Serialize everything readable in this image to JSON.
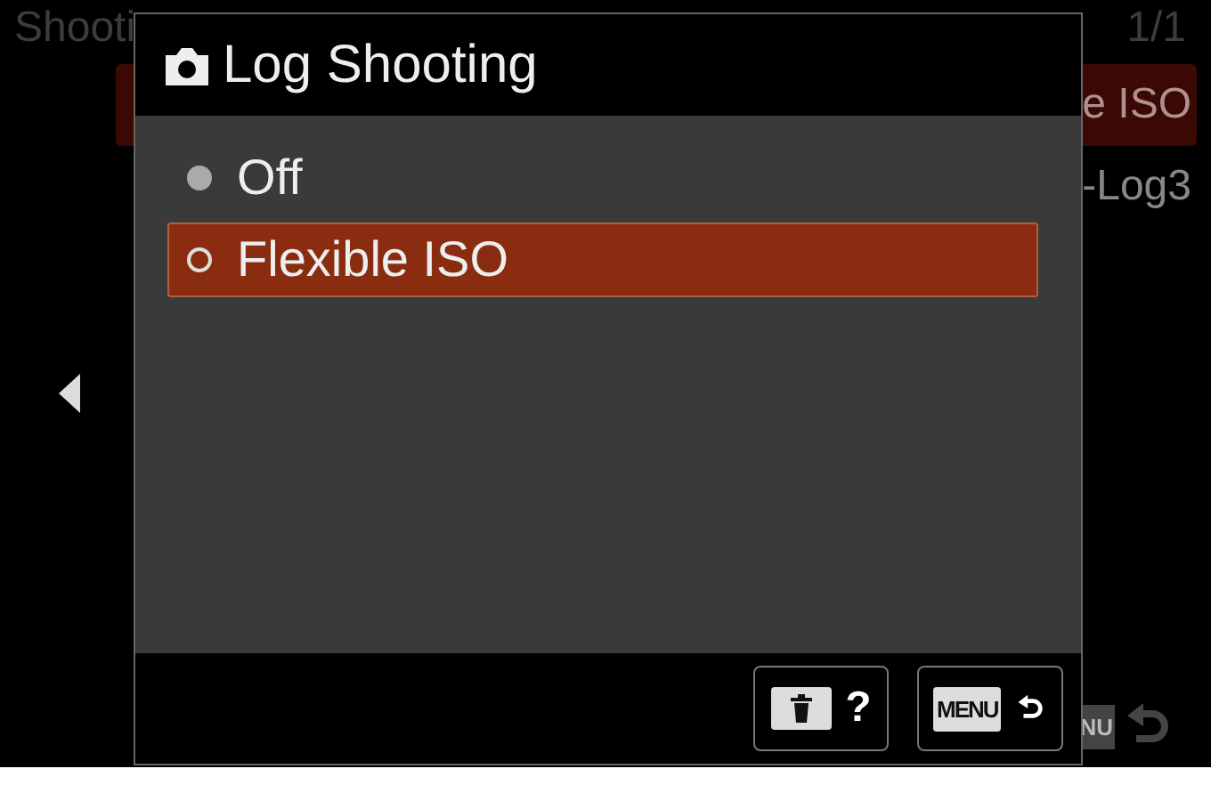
{
  "background": {
    "header": {
      "title": "Shooti",
      "page": "1/1"
    },
    "rows": [
      {
        "value": "e ISO",
        "selected": true
      },
      {
        "value": "-Log3",
        "selected": false
      }
    ],
    "footer_badge": "NU"
  },
  "dialog": {
    "title": "Log Shooting",
    "options": [
      {
        "label": "Off",
        "selected": false
      },
      {
        "label": "Flexible ISO",
        "selected": true
      }
    ],
    "buttons": [
      {
        "kind": "delete-help",
        "label": "?"
      },
      {
        "kind": "menu-back",
        "label": "MENU"
      }
    ]
  }
}
